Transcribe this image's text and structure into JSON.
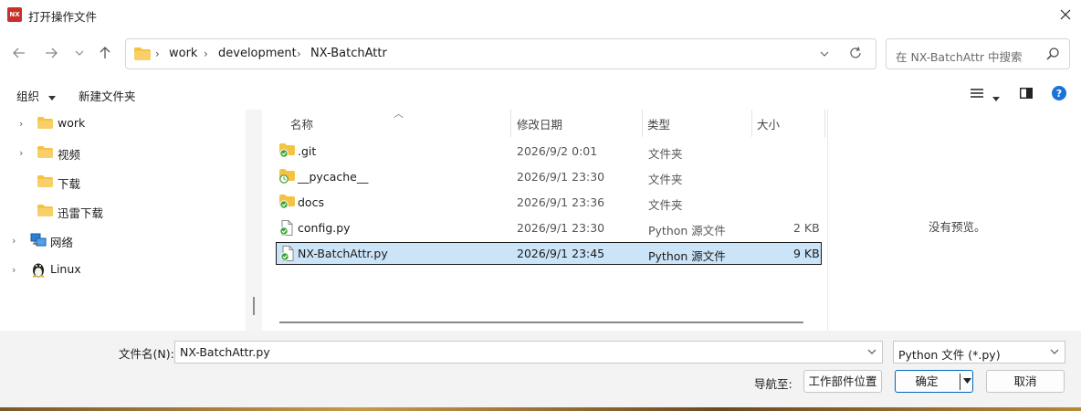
{
  "window": {
    "title": "打开操作文件",
    "app_icon_text": "NX"
  },
  "address": {
    "breadcrumbs": [
      "work",
      "development",
      "NX-BatchAttr"
    ]
  },
  "search": {
    "placeholder": "在 NX-BatchAttr 中搜索"
  },
  "toolbar": {
    "organize": "组织",
    "new_folder": "新建文件夹"
  },
  "nav_pane": {
    "items": [
      {
        "label": "work",
        "icon": "folder-icon",
        "expandable": true
      },
      {
        "label": "视频",
        "icon": "folder-icon",
        "expandable": true
      },
      {
        "label": "下载",
        "icon": "folder-icon",
        "expandable": false
      },
      {
        "label": "迅雷下载",
        "icon": "folder-icon",
        "expandable": false
      },
      {
        "label": "网络",
        "icon": "network-icon",
        "expandable": true
      },
      {
        "label": "Linux",
        "icon": "linux-penguin-icon",
        "expandable": true
      }
    ]
  },
  "file_list": {
    "columns": [
      "名称",
      "修改日期",
      "类型",
      "大小"
    ],
    "rows": [
      {
        "name": ".git",
        "date": "2026/9/2 0:01",
        "type": "文件夹",
        "size": "",
        "icon": "folder-synced-icon"
      },
      {
        "name": "__pycache__",
        "date": "2026/9/1 23:30",
        "type": "文件夹",
        "size": "",
        "icon": "folder-pending-icon"
      },
      {
        "name": "docs",
        "date": "2026/9/1 23:36",
        "type": "文件夹",
        "size": "",
        "icon": "folder-synced-icon"
      },
      {
        "name": "config.py",
        "date": "2026/9/1 23:30",
        "type": "Python 源文件",
        "size": "2 KB",
        "icon": "python-file-synced-icon"
      },
      {
        "name": "NX-BatchAttr.py",
        "date": "2026/9/1 23:45",
        "type": "Python 源文件",
        "size": "9 KB",
        "icon": "python-file-synced-icon",
        "selected": true
      }
    ]
  },
  "preview": {
    "text": "没有预览。"
  },
  "bottom": {
    "filename_label": "文件名(N):",
    "filename_value": "NX-BatchAttr.py",
    "filetype_value": "Python 文件 (*.py)",
    "nav_label": "导航至:",
    "workspace_button": "工作部件位置",
    "ok_button": "确定",
    "cancel_button": "取消"
  },
  "colors": {
    "accent": "#0067c0",
    "selection": "#cce4f7",
    "folder": "#f5c242",
    "sync_green": "#3aa53a"
  }
}
